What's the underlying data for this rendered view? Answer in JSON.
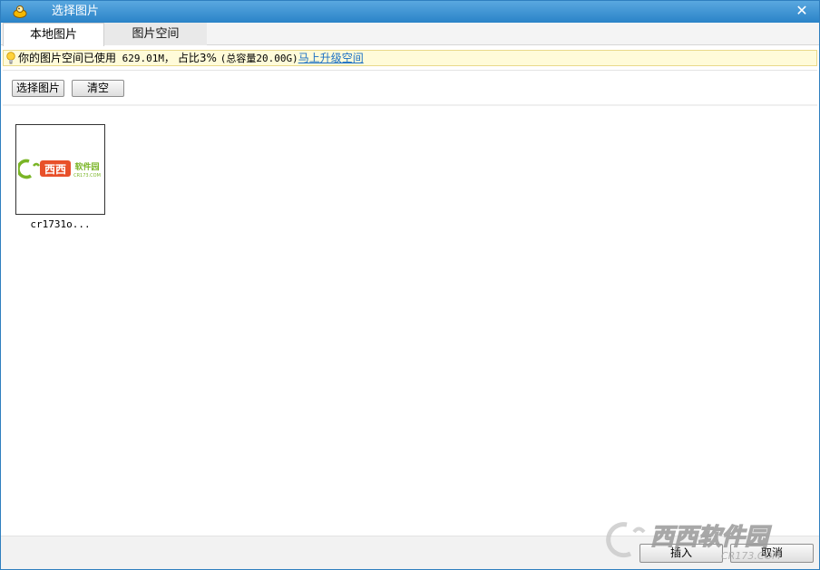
{
  "window": {
    "title": "选择图片",
    "close_glyph": "✕"
  },
  "tabs": [
    {
      "label": "本地图片",
      "active": true
    },
    {
      "label": "图片空间",
      "active": false
    }
  ],
  "notice": {
    "prefix": "你的图片空间已使用",
    "used": " 629.01M，",
    "ratio_label": "占比3%",
    "total": "(总容量20.00G)",
    "link": "马上升级空间"
  },
  "toolbar": {
    "select_label": "选择图片",
    "clear_label": "清空"
  },
  "images": [
    {
      "name": "cr1731o...",
      "logo_text": "西西",
      "logo_sub": "软件园",
      "logo_url": "CR173.COM"
    }
  ],
  "footer": {
    "insert_label": "插入",
    "cancel_label": "取消"
  },
  "watermark": {
    "text": "西西软件园",
    "sub": "CR173.COM"
  },
  "colors": {
    "titlebar": "#2a83c8",
    "notice_bg": "#fffbd9",
    "link": "#1a6fc4",
    "logo_green": "#7ab526",
    "logo_red": "#e8502a"
  }
}
